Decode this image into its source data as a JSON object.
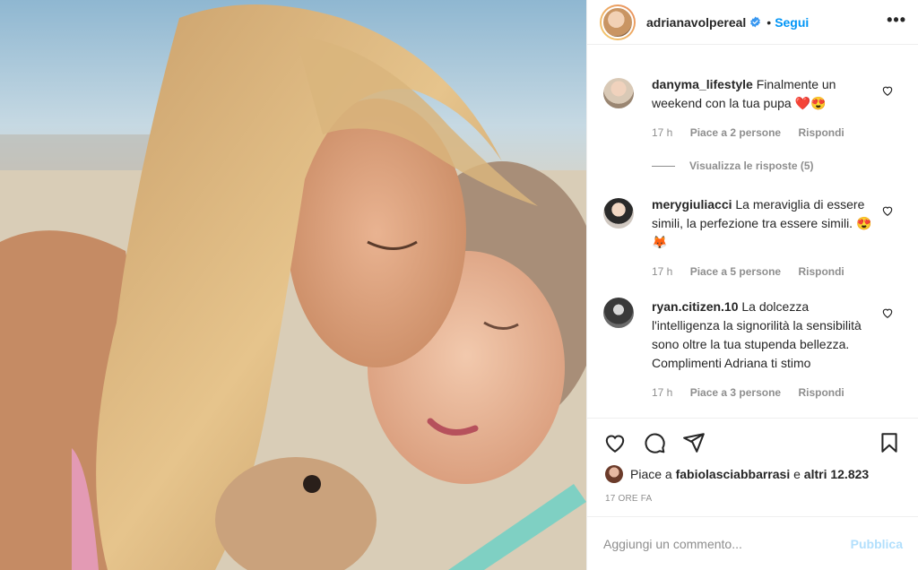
{
  "post": {
    "username": "adrianavolpereal",
    "verified_icon": "verified-badge-icon",
    "separator": "•",
    "follow_label": "Segui",
    "more_label": "•••"
  },
  "comments": [
    {
      "username": "danyma_lifestyle",
      "text": "Finalmente un weekend con la tua pupa ❤️😍",
      "time": "17 h",
      "likes": "Piace a 2 persone",
      "reply": "Rispondi",
      "view_replies": "Visualizza le risposte (5)"
    },
    {
      "username": "merygiuliacci",
      "text": "La meraviglia di essere simili, la perfezione tra essere simili. 😍🦊",
      "time": "17 h",
      "likes": "Piace a 5 persone",
      "reply": "Rispondi"
    },
    {
      "username": "ryan.citizen.10",
      "text": "La dolcezza l'intelligenza la signorilità la sensibilità sono oltre la tua stupenda bellezza. Complimenti Adriana ti stimo",
      "time": "17 h",
      "likes": "Piace a 3 persone",
      "reply": "Rispondi"
    }
  ],
  "actions": {
    "icons": [
      "heart-icon",
      "comment-icon",
      "share-icon",
      "bookmark-icon"
    ],
    "likes_prefix": "Piace a",
    "likes_user": "fabiolasciabbarrasi",
    "likes_mid": "e",
    "likes_others": "altri 12.823",
    "timestamp": "17 ORE FA"
  },
  "add_comment": {
    "placeholder": "Aggiungi un commento...",
    "publish_label": "Pubblica"
  },
  "colors": {
    "link_blue": "#0095f6",
    "publish_disabled": "#b2dffc",
    "muted": "#8e8e8e",
    "heart_red": "#ed4956"
  }
}
